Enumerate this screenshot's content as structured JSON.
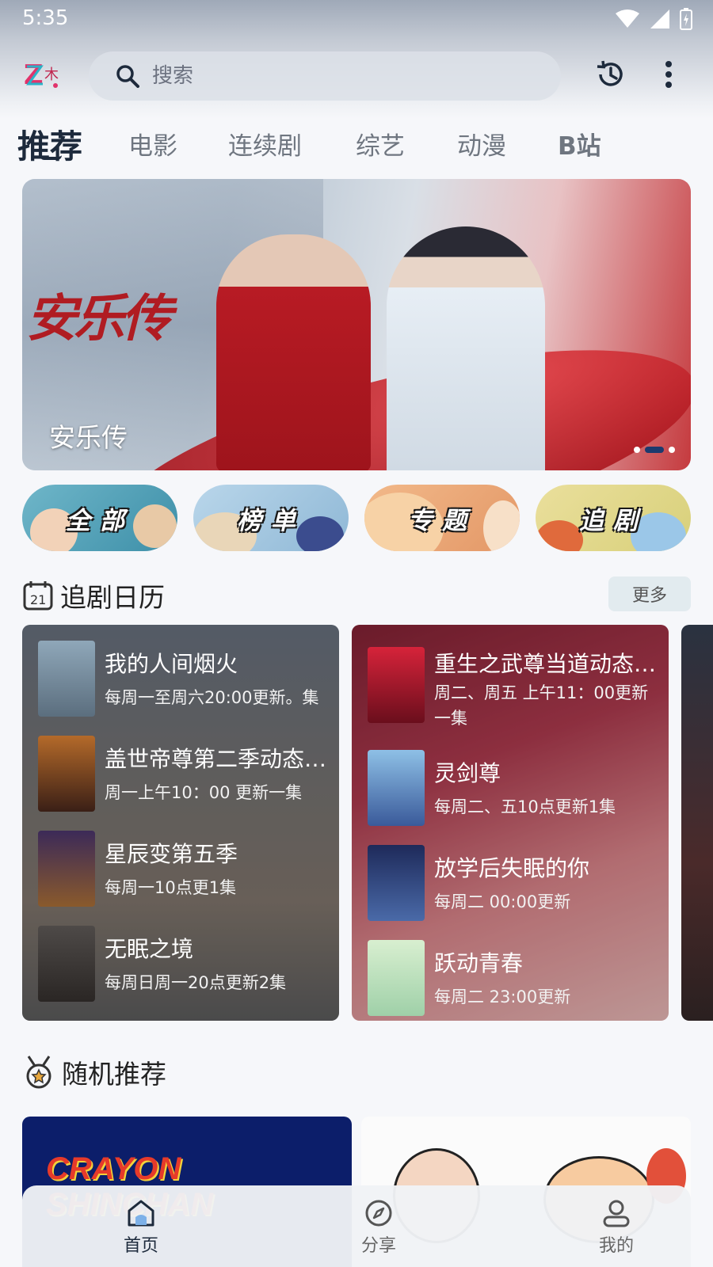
{
  "status_bar": {
    "time": "5:35"
  },
  "header": {
    "search_placeholder": "搜索"
  },
  "tabs": [
    {
      "label": "推荐",
      "active": true
    },
    {
      "label": "电影"
    },
    {
      "label": "连续剧"
    },
    {
      "label": "综艺"
    },
    {
      "label": "动漫"
    },
    {
      "label": "B站"
    }
  ],
  "banner": {
    "title": "安乐传",
    "caption": "安乐传",
    "slides": 3,
    "active_slide": 2
  },
  "categories": [
    {
      "label": "全部"
    },
    {
      "label": "榜单"
    },
    {
      "label": "专题"
    },
    {
      "label": "追剧"
    }
  ],
  "calendar": {
    "title": "追剧日历",
    "more_label": "更多",
    "cards": [
      {
        "items": [
          {
            "title": "我的人间烟火",
            "schedule": "每周一至周六20:00更新。集"
          },
          {
            "title": "盖世帝尊第二季动态漫画",
            "schedule": "周一上午10：00 更新一集"
          },
          {
            "title": "星辰变第五季",
            "schedule": "每周一10点更1集"
          },
          {
            "title": "无眠之境",
            "schedule": "每周日周一20点更新2集"
          }
        ]
      },
      {
        "items": [
          {
            "title": "重生之武尊当道动态漫画",
            "schedule": "周二、周五 上午11：00更新一集"
          },
          {
            "title": "灵剑尊",
            "schedule": "每周二、五10点更新1集"
          },
          {
            "title": "放学后失眠的你",
            "schedule": "每周二 00:00更新"
          },
          {
            "title": "跃动青春",
            "schedule": "每周二 23:00更新"
          }
        ]
      }
    ]
  },
  "random": {
    "title": "随机推荐",
    "cards": [
      {
        "title": "CRAYON SHINCHAN"
      }
    ]
  },
  "bottom_nav": [
    {
      "label": "首页",
      "active": true
    },
    {
      "label": "分享"
    },
    {
      "label": "我的"
    }
  ],
  "colors": {
    "accent": "#1d2a3c",
    "banner_red": "#b81b24"
  }
}
